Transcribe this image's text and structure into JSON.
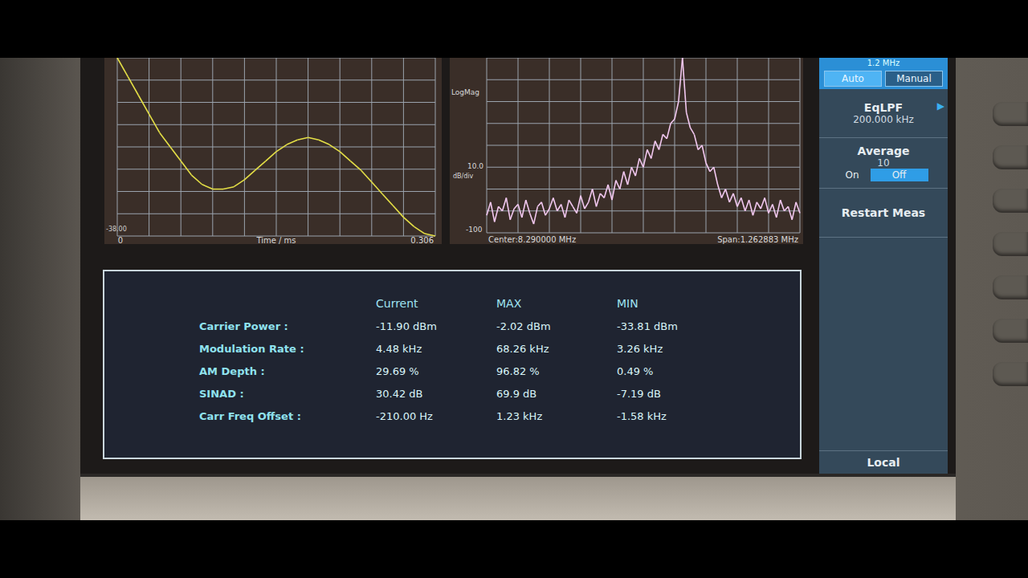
{
  "charts": {
    "waveform": {
      "y_tick": "-38.00",
      "x_start": "0",
      "x_label": "Time / ms",
      "x_end": "0.306",
      "y_min": -38,
      "y_max": 0,
      "values": [
        0,
        -4,
        -8,
        -12,
        -16,
        -19,
        -22,
        -25,
        -27,
        -28,
        -28,
        -27.5,
        -26,
        -24,
        -22,
        -20,
        -18.5,
        -17.5,
        -17,
        -17.5,
        -18.5,
        -20,
        -22,
        -24,
        -26.5,
        -29,
        -31.5,
        -34,
        -36,
        -37.5,
        -38
      ]
    },
    "spectrum": {
      "scale_label": "LogMag",
      "div_value": "10.0",
      "div_unit": "dB/div",
      "y_bottom": "-100",
      "center": "Center:8.290000 MHz",
      "span": "Span:1.262883 MHz",
      "y_min": -100,
      "y_max": -20,
      "values": [
        -92,
        -86,
        -95,
        -88,
        -90,
        -84,
        -94,
        -89,
        -87,
        -93,
        -85,
        -91,
        -96,
        -88,
        -86,
        -92,
        -89,
        -84,
        -90,
        -87,
        -93,
        -85,
        -88,
        -91,
        -83,
        -89,
        -86,
        -80,
        -88,
        -82,
        -84,
        -78,
        -85,
        -76,
        -80,
        -72,
        -78,
        -70,
        -74,
        -66,
        -70,
        -62,
        -66,
        -58,
        -62,
        -55,
        -57,
        -50,
        -48,
        -40,
        -20,
        -45,
        -52,
        -55,
        -62,
        -60,
        -68,
        -72,
        -70,
        -78,
        -84,
        -80,
        -86,
        -82,
        -88,
        -84,
        -90,
        -85,
        -92,
        -86,
        -89,
        -84,
        -91,
        -87,
        -93,
        -85,
        -90,
        -88,
        -94,
        -86,
        -91
      ]
    }
  },
  "sidebar": {
    "top_value": "1.2 MHz",
    "mode": [
      {
        "label": "Auto",
        "selected": true
      },
      {
        "label": "Manual",
        "selected": false
      }
    ],
    "eqlpf_label": "EqLPF",
    "eqlpf_value": "200.000 kHz",
    "eqlpf_arrow": "▶",
    "average_label": "Average",
    "average_value": "10",
    "average_toggle": [
      {
        "label": "On",
        "selected": false
      },
      {
        "label": "Off",
        "selected": true
      }
    ],
    "restart": "Restart Meas",
    "local": "Local"
  },
  "table": {
    "columns": [
      "Current",
      "MAX",
      "MIN"
    ],
    "rows": [
      [
        "Carrier Power :",
        "-11.90 dBm",
        "-2.02 dBm",
        "-33.81 dBm"
      ],
      [
        "Modulation Rate :",
        "4.48 kHz",
        "68.26 kHz",
        "3.26 kHz"
      ],
      [
        "AM Depth :",
        "29.69 %",
        "96.82 %",
        "0.49 %"
      ],
      [
        "SINAD :",
        "30.42 dB",
        "69.9 dB",
        "-7.19 dB"
      ],
      [
        "Carr Freq Offset :",
        "-210.00 Hz",
        "1.23 kHz",
        "-1.58 kHz"
      ]
    ]
  }
}
